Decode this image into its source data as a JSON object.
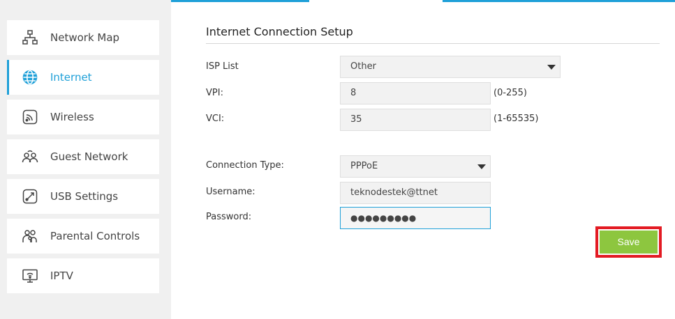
{
  "sidebar": {
    "items": [
      {
        "label": "Network Map",
        "icon": "network-map-icon"
      },
      {
        "label": "Internet",
        "icon": "globe-icon",
        "active": true
      },
      {
        "label": "Wireless",
        "icon": "wireless-icon"
      },
      {
        "label": "Guest Network",
        "icon": "guest-network-icon"
      },
      {
        "label": "USB Settings",
        "icon": "usb-settings-icon"
      },
      {
        "label": "Parental Controls",
        "icon": "parental-controls-icon"
      },
      {
        "label": "IPTV",
        "icon": "iptv-icon"
      }
    ]
  },
  "main": {
    "title": "Internet Connection Setup",
    "isp_list": {
      "label": "ISP List",
      "value": "Other"
    },
    "vpi": {
      "label": "VPI:",
      "value": "8",
      "range": "(0-255)"
    },
    "vci": {
      "label": "VCI:",
      "value": "35",
      "range": "(1-65535)"
    },
    "connection_type": {
      "label": "Connection Type:",
      "value": "PPPoE"
    },
    "username": {
      "label": "Username:",
      "value": "teknodestek@ttnet"
    },
    "password": {
      "label": "Password:",
      "value": "●●●●●●●●●"
    },
    "save_label": "Save"
  },
  "colors": {
    "accent": "#1fa0d8",
    "save_button": "#8dc63f",
    "highlight_outline": "#e31b23"
  }
}
